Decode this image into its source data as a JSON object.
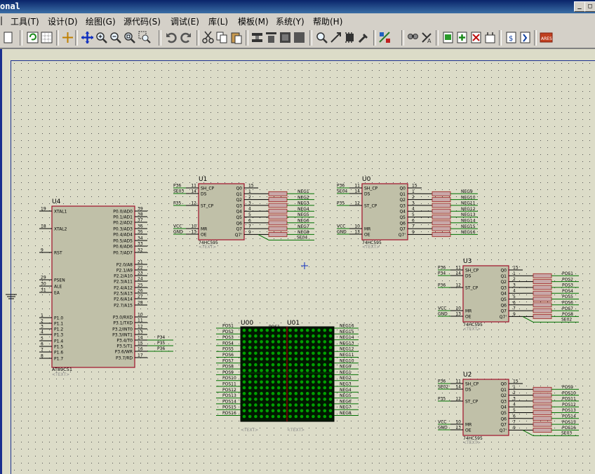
{
  "window": {
    "title": "onal"
  },
  "menu": [
    "工具(T)",
    "设计(D)",
    "绘图(G)",
    "源代码(S)",
    "调试(E)",
    "库(L)",
    "模板(M)",
    "系统(Y)",
    "帮助(H)"
  ],
  "toolbar_icons": [
    "new-file-icon",
    "refresh-icon",
    "grid-icon",
    "origin-icon",
    "pan-icon",
    "zoom-in-icon",
    "zoom-out-icon",
    "zoom-all-icon",
    "zoom-area-icon",
    "undo-icon",
    "redo-icon",
    "cut-icon",
    "copy-icon",
    "paste-icon",
    "block-copy-icon",
    "block-move-icon",
    "block-rotate-icon",
    "block-delete-icon",
    "pick-device-icon",
    "make-device-icon",
    "package-icon",
    "decompose-icon",
    "wire-autoroute-icon",
    "search-icon",
    "property-tool-icon",
    "netlist-icon",
    "add-sheet-icon",
    "remove-sheet-icon",
    "bom-icon",
    "erc-icon",
    "netlist-to-ares-icon",
    "ares-icon"
  ],
  "colors": {
    "part_fill": "#c0c0a8",
    "part_border": "#a0102a",
    "pin": "#000000",
    "wire": "#007000",
    "dot_grid": "#505050",
    "led_on": "#00a000",
    "led_off": "#005000"
  },
  "u4": {
    "ref": "U4",
    "type": "AT89C51",
    "text": "<TEXT>",
    "left_pins": [
      {
        "num": "19",
        "name": "XTAL1"
      },
      {
        "num": "18",
        "name": "XTAL2"
      },
      {
        "num": "9",
        "name": "RST"
      },
      {
        "num": "29",
        "name": "PSEN"
      },
      {
        "num": "30",
        "name": "ALE"
      },
      {
        "num": "31",
        "name": "EA"
      },
      {
        "num": "1",
        "name": "P1.0"
      },
      {
        "num": "2",
        "name": "P1.1"
      },
      {
        "num": "3",
        "name": "P1.2"
      },
      {
        "num": "4",
        "name": "P1.3"
      },
      {
        "num": "5",
        "name": "P1.4"
      },
      {
        "num": "6",
        "name": "P1.5"
      },
      {
        "num": "7",
        "name": "P1.6"
      },
      {
        "num": "8",
        "name": "P1.7"
      }
    ],
    "right_pins": [
      {
        "num": "39",
        "name": "P0.0/AD0"
      },
      {
        "num": "38",
        "name": "P0.1/AD1"
      },
      {
        "num": "37",
        "name": "P0.2/AD2"
      },
      {
        "num": "36",
        "name": "P0.3/AD3"
      },
      {
        "num": "35",
        "name": "P0.4/AD4"
      },
      {
        "num": "34",
        "name": "P0.5/AD5"
      },
      {
        "num": "33",
        "name": "P0.6/AD6"
      },
      {
        "num": "32",
        "name": "P0.7/AD7"
      },
      {
        "num": "21",
        "name": "P2.0/A8"
      },
      {
        "num": "22",
        "name": "P2.1/A9"
      },
      {
        "num": "23",
        "name": "P2.2/A10"
      },
      {
        "num": "24",
        "name": "P2.3/A11"
      },
      {
        "num": "25",
        "name": "P2.4/A12"
      },
      {
        "num": "26",
        "name": "P2.5/A13"
      },
      {
        "num": "27",
        "name": "P2.6/A14"
      },
      {
        "num": "28",
        "name": "P2.7/A15"
      },
      {
        "num": "10",
        "name": "P3.0/RXD"
      },
      {
        "num": "11",
        "name": "P3.1/TXD"
      },
      {
        "num": "12",
        "name": "P3.2/INT0"
      },
      {
        "num": "13",
        "name": "P3.3/INT1"
      },
      {
        "num": "14",
        "name": "P3.4/T0"
      },
      {
        "num": "15",
        "name": "P3.5/T1"
      },
      {
        "num": "16",
        "name": "P3.6/WR"
      },
      {
        "num": "17",
        "name": "P3.7/RD"
      }
    ],
    "net_labels": [
      "P34",
      "P35",
      "P36"
    ]
  },
  "shift_registers": [
    {
      "ref": "U1",
      "type": "74HC595",
      "text": "<TEXT>",
      "in_labels": [
        "P36",
        "SE03",
        "P35",
        "VCC",
        "GND"
      ],
      "in_nums": [
        "11",
        "14",
        "12",
        "10",
        "13"
      ],
      "outputs": [
        "NEG1",
        "NEG2",
        "NEG3",
        "NEG4",
        "NEG5",
        "NEG6",
        "NEG7",
        "NEG8"
      ],
      "chain": "SE04"
    },
    {
      "ref": "U0",
      "type": "74HC595",
      "text": "<TEXT>",
      "in_labels": [
        "P36",
        "SE04",
        "P35",
        "VCC",
        "GND"
      ],
      "in_nums": [
        "11",
        "14",
        "12",
        "10",
        "13"
      ],
      "outputs": [
        "NEG9",
        "NEG10",
        "NEG11",
        "NEG12",
        "NEG13",
        "NEG14",
        "NEG15",
        "NEG16"
      ],
      "chain": ""
    },
    {
      "ref": "U3",
      "type": "74HC595",
      "text": "<TEXT>",
      "in_labels": [
        "P36",
        "P34",
        "P36",
        "VCC",
        "GND"
      ],
      "in_nums": [
        "11",
        "14",
        "12",
        "10",
        "13"
      ],
      "outputs": [
        "POS1",
        "POS2",
        "POS3",
        "POS4",
        "POS5",
        "POS6",
        "POS7",
        "POS8"
      ],
      "chain": "SE02"
    },
    {
      "ref": "U2",
      "type": "74HC595",
      "text": "<TEXT>",
      "in_labels": [
        "P36",
        "SE02",
        "P35",
        "VCC",
        "GND"
      ],
      "in_nums": [
        "11",
        "14",
        "12",
        "10",
        "13"
      ],
      "outputs": [
        "POS9",
        "POS10",
        "POS11",
        "POS12",
        "POS13",
        "POS14",
        "POS15",
        "POS16"
      ],
      "chain": "SE03"
    }
  ],
  "hc595_pins": {
    "left": [
      "SH_CP",
      "DS",
      "ST_CP",
      "MR",
      "OE"
    ],
    "right": [
      "Q0",
      "Q1",
      "Q2",
      "Q3",
      "Q4",
      "Q5",
      "Q6",
      "Q7",
      "Q7'"
    ],
    "right_nums": [
      "15",
      "1",
      "2",
      "3",
      "4",
      "5",
      "6",
      "7",
      "9"
    ]
  },
  "matrix": {
    "refs": [
      "U00",
      "U01"
    ],
    "pos_labels": [
      "POS1",
      "POS2",
      "POS3",
      "POS4",
      "POS5",
      "POS6",
      "POS7",
      "POS8",
      "POS9",
      "POS10",
      "POS11",
      "POS12",
      "POS13",
      "POS14",
      "POS15",
      "POS16"
    ],
    "neg_labels": [
      "NEG16",
      "NEG15",
      "NEG14",
      "NEG13",
      "NEG12",
      "NEG11",
      "NEG10",
      "NEG9",
      "NEG1",
      "NEG2",
      "NEG3",
      "NEG4",
      "NEG5",
      "NEG6",
      "NEG7",
      "NEG8"
    ],
    "text": "<TEXT>"
  }
}
